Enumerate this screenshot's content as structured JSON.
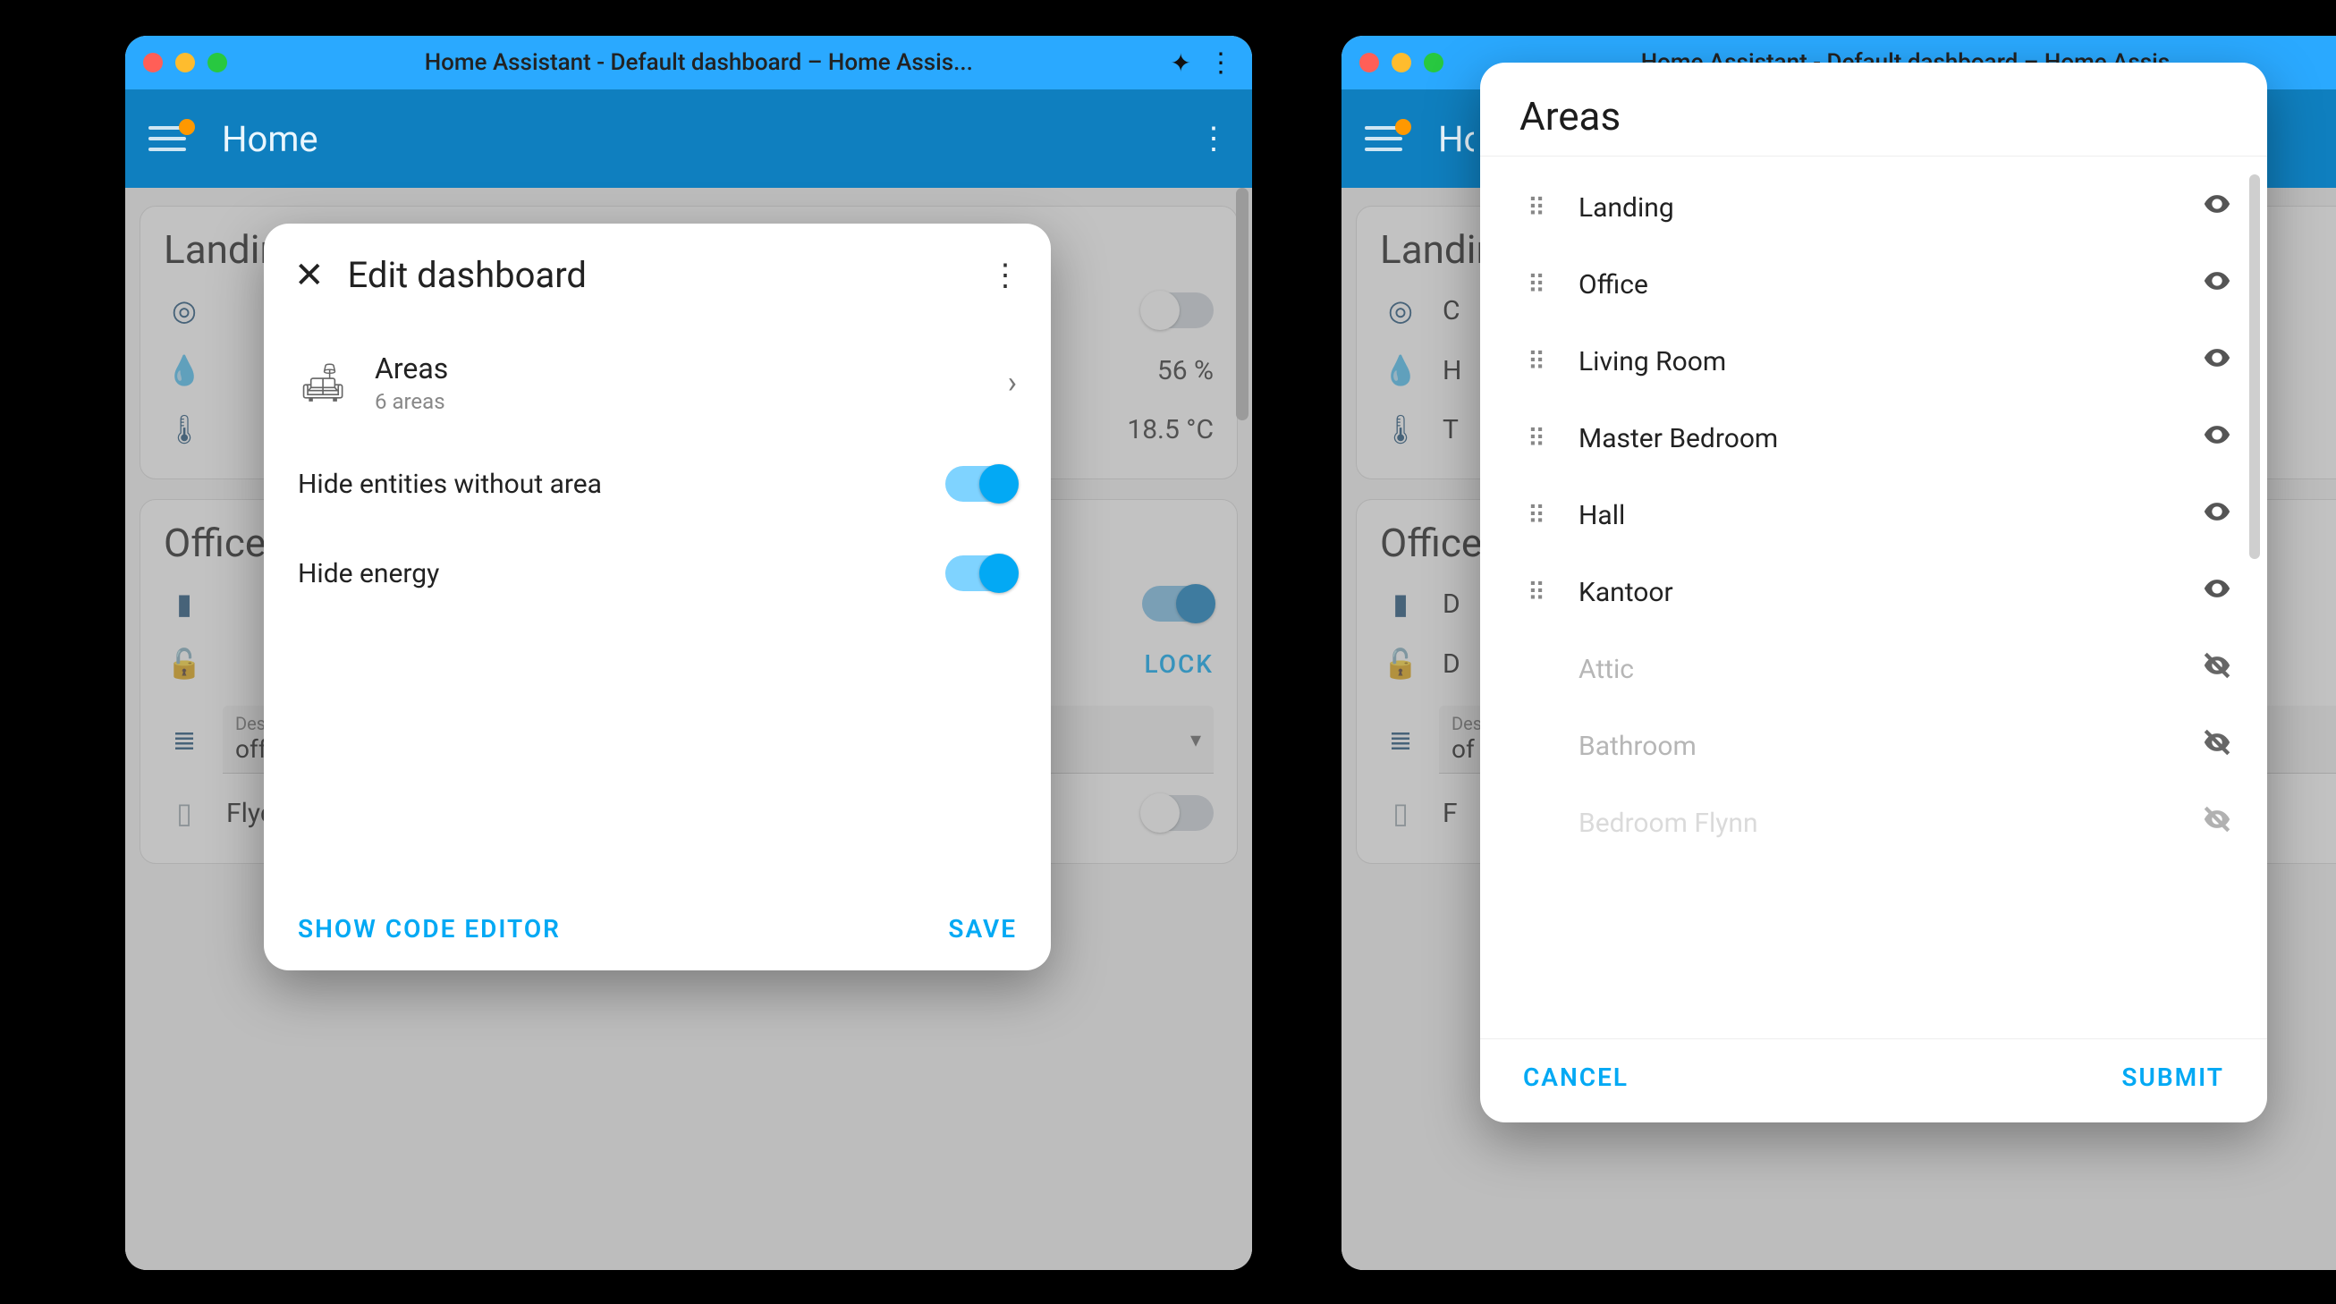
{
  "window": {
    "title": "Home Assistant - Default dashboard – Home Assis..."
  },
  "appbar": {
    "title": "Home"
  },
  "landing_card": {
    "title": "Landing",
    "rows": [
      {
        "icon": "ceiling-light",
        "label_hidden": "C",
        "toggle": false
      },
      {
        "icon": "water-drop",
        "label_hidden": "H",
        "value": "56 %"
      },
      {
        "icon": "thermometer",
        "label_hidden": "T",
        "value": "18.5 °C"
      }
    ]
  },
  "office_card": {
    "title": "Office",
    "rows": [
      {
        "icon": "device",
        "label": "D",
        "toggle": true
      },
      {
        "icon": "lock-open",
        "label": "D",
        "lock_label": "LOCK"
      }
    ],
    "select": {
      "label": "Desk Indicator Mode",
      "value": "off/on"
    },
    "flycatcher": {
      "label": "Flycatcher",
      "toggle": false
    }
  },
  "edit_modal": {
    "title": "Edit dashboard",
    "areas": {
      "title": "Areas",
      "subtitle": "6 areas"
    },
    "options": [
      {
        "label": "Hide entities without area",
        "on": true
      },
      {
        "label": "Hide energy",
        "on": true
      }
    ],
    "show_code": "SHOW CODE EDITOR",
    "save": "SAVE"
  },
  "areas_modal": {
    "title": "Areas",
    "visible": [
      {
        "name": "Landing"
      },
      {
        "name": "Office"
      },
      {
        "name": "Living Room"
      },
      {
        "name": "Master Bedroom"
      },
      {
        "name": "Hall"
      },
      {
        "name": "Kantoor"
      }
    ],
    "hidden": [
      {
        "name": "Attic"
      },
      {
        "name": "Bathroom"
      },
      {
        "name": "Bedroom Flynn"
      }
    ],
    "cancel": "CANCEL",
    "submit": "SUBMIT"
  }
}
